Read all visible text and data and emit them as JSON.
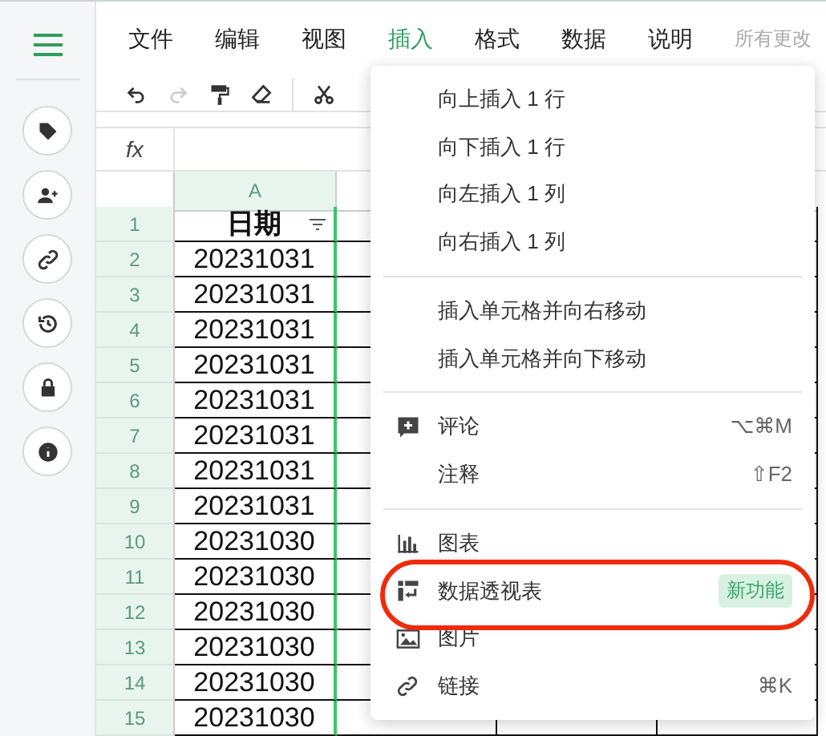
{
  "menu_bar": [
    {
      "label": "文件",
      "selected": false
    },
    {
      "label": "编辑",
      "selected": false
    },
    {
      "label": "视图",
      "selected": false
    },
    {
      "label": "插入",
      "selected": true
    },
    {
      "label": "格式",
      "selected": false
    },
    {
      "label": "数据",
      "selected": false
    },
    {
      "label": "说明",
      "selected": false
    }
  ],
  "save_status": "所有更改",
  "formula_bar": {
    "label": "fx"
  },
  "sheet": {
    "column_header": "A",
    "rows": [
      {
        "number": "1",
        "value": "日期",
        "kind": "header"
      },
      {
        "number": "2",
        "value": "20231031",
        "kind": "data"
      },
      {
        "number": "3",
        "value": "20231031",
        "kind": "data"
      },
      {
        "number": "4",
        "value": "20231031",
        "kind": "data"
      },
      {
        "number": "5",
        "value": "20231031",
        "kind": "data"
      },
      {
        "number": "6",
        "value": "20231031",
        "kind": "data"
      },
      {
        "number": "7",
        "value": "20231031",
        "kind": "data"
      },
      {
        "number": "8",
        "value": "20231031",
        "kind": "data"
      },
      {
        "number": "9",
        "value": "20231031",
        "kind": "data"
      },
      {
        "number": "10",
        "value": "20231030",
        "kind": "data"
      },
      {
        "number": "11",
        "value": "20231030",
        "kind": "data"
      },
      {
        "number": "12",
        "value": "20231030",
        "kind": "data"
      },
      {
        "number": "13",
        "value": "20231030",
        "kind": "data"
      },
      {
        "number": "14",
        "value": "20231030",
        "kind": "data"
      },
      {
        "number": "15",
        "value": "20231030",
        "kind": "data"
      }
    ]
  },
  "insert_menu": {
    "groups": [
      [
        {
          "label": "向上插入 1 行",
          "kind": "plain"
        },
        {
          "label": "向下插入 1 行",
          "kind": "plain"
        },
        {
          "label": "向左插入 1 列",
          "kind": "plain"
        },
        {
          "label": "向右插入 1 列",
          "kind": "plain"
        }
      ],
      [
        {
          "label": "插入单元格并向右移动",
          "kind": "plain"
        },
        {
          "label": "插入单元格并向下移动",
          "kind": "plain"
        }
      ],
      [
        {
          "label": "评论",
          "kind": "comment",
          "shortcut": "⌥⌘M"
        },
        {
          "label": "注释",
          "kind": "plain",
          "shortcut": "⇧F2"
        }
      ],
      [
        {
          "label": "图表",
          "kind": "chart"
        },
        {
          "label": "数据透视表",
          "kind": "pivot",
          "badge": "新功能",
          "highlighted": true
        },
        {
          "label": "图片",
          "kind": "image"
        },
        {
          "label": "链接",
          "kind": "link",
          "shortcut": "⌘K"
        }
      ]
    ]
  }
}
